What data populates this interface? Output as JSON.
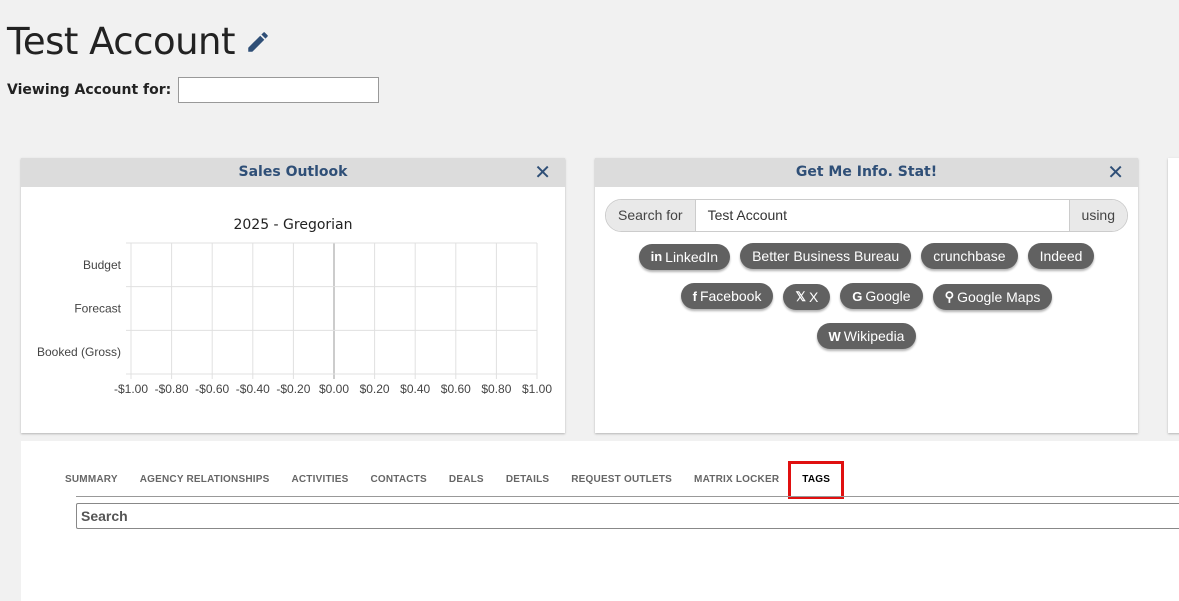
{
  "header": {
    "title": "Test Account",
    "viewing_label": "Viewing Account for:",
    "viewing_value": ""
  },
  "sales_outlook": {
    "title": "Sales Outlook",
    "close": "✕",
    "chart_title": "2025 - Gregorian"
  },
  "chart_data": {
    "type": "bar",
    "orientation": "horizontal",
    "title": "2025 - Gregorian",
    "categories": [
      "Budget",
      "Forecast",
      "Booked (Gross)"
    ],
    "values": [
      0,
      0,
      0
    ],
    "xticks": [
      "-$1.00",
      "-$0.80",
      "-$0.60",
      "-$0.40",
      "-$0.20",
      "$0.00",
      "$0.20",
      "$0.40",
      "$0.60",
      "$0.80",
      "$1.00"
    ],
    "xlim": [
      -1,
      1
    ],
    "grid": true
  },
  "info_panel": {
    "title": "Get Me Info. Stat!",
    "close": "✕",
    "search_prefix": "Search for",
    "search_value": "Test Account",
    "search_suffix": "using",
    "buttons": [
      {
        "label": "LinkedIn",
        "icon": "in"
      },
      {
        "label": "Better Business Bureau",
        "icon": ""
      },
      {
        "label": "crunchbase",
        "icon": ""
      },
      {
        "label": "Indeed",
        "icon": ""
      },
      {
        "label": "Facebook",
        "icon": "f"
      },
      {
        "label": "X",
        "icon": "𝕏"
      },
      {
        "label": "Google",
        "icon": "G"
      },
      {
        "label": "Google Maps",
        "icon": "⚲"
      },
      {
        "label": "Wikipedia",
        "icon": "W"
      }
    ]
  },
  "tabs": [
    "SUMMARY",
    "AGENCY RELATIONSHIPS",
    "ACTIVITIES",
    "CONTACTS",
    "DEALS",
    "DETAILS",
    "REQUEST OUTLETS",
    "MATRIX LOCKER",
    "TAGS"
  ],
  "active_tab": "TAGS",
  "tags": {
    "search_placeholder": "Search"
  },
  "colors": {
    "accent": "#2f4f77",
    "pill": "#616161",
    "highlight": "#e01010"
  }
}
